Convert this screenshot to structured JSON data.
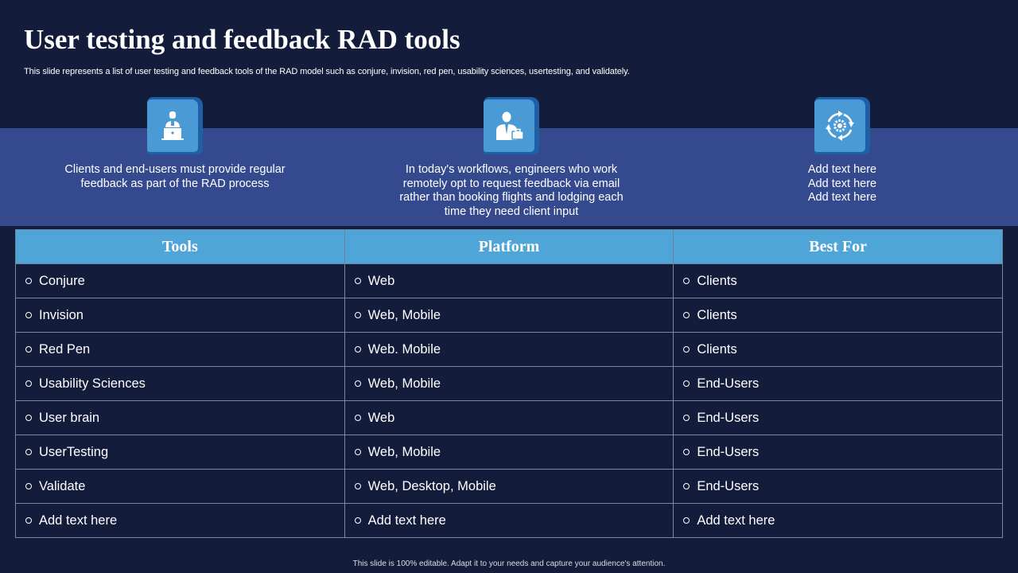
{
  "title": "User testing and feedback RAD tools",
  "subtitle": "This slide represents a list of user testing and feedback tools of the RAD model such as conjure, invision, red pen, usability sciences, usertesting, and validately.",
  "features": [
    {
      "icon": "user-laptop-icon",
      "text": "Clients and end-users must provide regular feedback as part of the RAD process"
    },
    {
      "icon": "businessman-icon",
      "text": "In today's workflows, engineers who work remotely opt to request feedback via email rather than booking flights and lodging each time they need client input"
    },
    {
      "icon": "gear-cycle-icon",
      "lines": [
        "Add text here",
        "Add text here",
        "Add text here"
      ]
    }
  ],
  "table": {
    "headers": [
      "Tools",
      "Platform",
      "Best For"
    ],
    "rows": [
      [
        "Conjure",
        "Web",
        "Clients"
      ],
      [
        "Invision",
        "Web, Mobile",
        "Clients"
      ],
      [
        "Red Pen",
        "Web. Mobile",
        "Clients"
      ],
      [
        "Usability Sciences",
        "Web, Mobile",
        "End-Users"
      ],
      [
        "User brain",
        "Web",
        "End-Users"
      ],
      [
        "UserTesting",
        "Web, Mobile",
        "End-Users"
      ],
      [
        "Validate",
        "Web, Desktop, Mobile",
        "End-Users"
      ],
      [
        "Add text here",
        "Add text here",
        "Add text here"
      ]
    ]
  },
  "footer": "This slide is 100% editable. Adapt it to your needs and capture your audience's attention.",
  "colors": {
    "background": "#141c3b",
    "band": "#354a8e",
    "header": "#4fa5d8",
    "icon_tile": "#4a9ad6"
  }
}
